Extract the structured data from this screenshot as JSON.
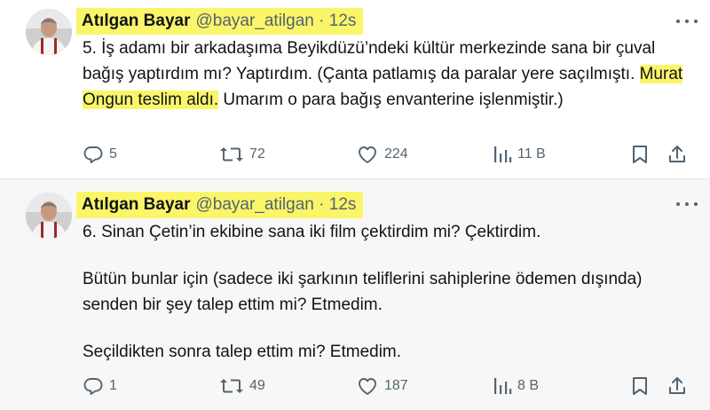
{
  "tweets": [
    {
      "author": {
        "name": "Atılgan Bayar",
        "handle": "@bayar_atilgan",
        "time": "12s"
      },
      "body": {
        "text_before": "5. İş adamı bir arkadaşıma Beyikdüzü’ndeki kültür merkezinde sana bir çuval bağış yaptırdım mı? Yaptırdım. (Çanta patlamış da paralar yere saçılmıştı. ",
        "highlighted": "Murat Ongun teslim aldı.",
        "text_after": " Umarım o para bağış envanterine işlenmiştir.)"
      },
      "stats": {
        "replies": "5",
        "retweets": "72",
        "likes": "224",
        "views": "11 B"
      }
    },
    {
      "author": {
        "name": "Atılgan Bayar",
        "handle": "@bayar_atilgan",
        "time": "12s"
      },
      "body": {
        "paragraphs": [
          "6. Sinan Çetin’in ekibine sana iki film çektirdim mi? Çektirdim.",
          "Bütün bunlar için (sadece iki şarkının teliflerini sahiplerine ödemen dışında) senden bir şey talep ettim mi? Etmedim.",
          "Seçildikten sonra talep ettim mi? Etmedim."
        ]
      },
      "stats": {
        "replies": "1",
        "retweets": "49",
        "likes": "187",
        "views": "8 B"
      }
    }
  ],
  "separator": "·",
  "icons": [
    "reply-icon",
    "retweet-icon",
    "like-icon",
    "views-icon",
    "bookmark-icon",
    "share-icon",
    "more-icon"
  ],
  "colors": {
    "highlight": "#fbf56a",
    "secondary_text": "#536471",
    "primary_text": "#0f1419"
  }
}
